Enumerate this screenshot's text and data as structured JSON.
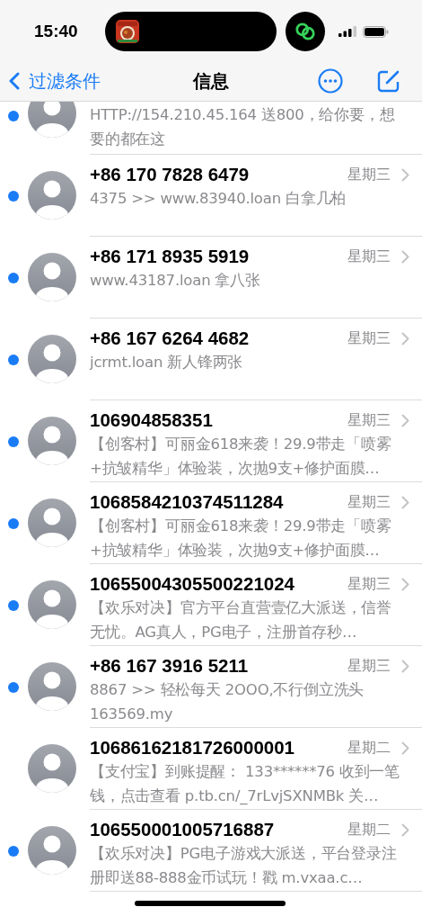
{
  "status_bar": {
    "time": "15:40"
  },
  "nav": {
    "back_label": "过滤条件",
    "title": "信息"
  },
  "conversations": [
    {
      "unread": true,
      "preview": "HTTP://154.210.45.164 送800，给你要，想要的都在这"
    },
    {
      "unread": true,
      "name": "+86 170 7828 6479",
      "date": "星期三",
      "preview": "4375 >>  www.83940.loan  白拿几柏"
    },
    {
      "unread": true,
      "name": "+86 171 8935 5919",
      "date": "星期三",
      "preview": "www.43187.loan   拿八张"
    },
    {
      "unread": true,
      "name": "+86 167 6264 4682",
      "date": "星期三",
      "preview": "jcrmt.loan 新人锋两张"
    },
    {
      "unread": true,
      "name": "106904858351",
      "date": "星期三",
      "preview": "【创客村】可丽金618来袭！29.9带走「喷雾+抗皱精华」体验装，次抛9支+修护面膜…"
    },
    {
      "unread": true,
      "name": "1068584210374511284",
      "date": "星期三",
      "preview": "【创客村】可丽金618来袭！29.9带走「喷雾+抗皱精华」体验装，次抛9支+修护面膜…"
    },
    {
      "unread": true,
      "name": "10655004305500221024",
      "date": "星期三",
      "preview": "【欢乐对决】官方平台直营壹亿大派送，信誉无忧。AG真人，PG电子，注册首存秒…"
    },
    {
      "unread": true,
      "name": "+86 167 3916 5211",
      "date": "星期三",
      "preview": "8867 >>  轻松每天 2OOO,不行倒立洗头 163569.my"
    },
    {
      "unread": false,
      "name": "10686162181726000001",
      "date": "星期二",
      "preview": "【支付宝】到账提醒： 133******76 收到一笔钱，点击查看 p.tb.cn/_7rLvjSXNMBk 关…"
    },
    {
      "unread": true,
      "name": "106550001005716887",
      "date": "星期二",
      "preview": "【欢乐对决】PG电子游戏大派送，平台登录注册即送88-888金币试玩！戳 m.vxaa.c…"
    }
  ]
}
